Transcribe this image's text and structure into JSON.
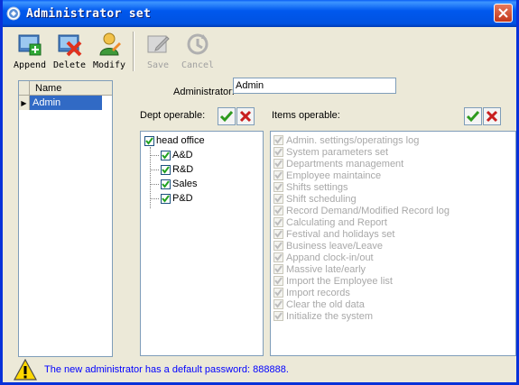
{
  "window": {
    "title": "Administrator set"
  },
  "toolbar": {
    "append": "Append",
    "delete": "Delete",
    "modify": "Modify",
    "save": "Save",
    "cancel": "Cancel"
  },
  "grid": {
    "column": "Name",
    "rows": [
      "Admin"
    ]
  },
  "form": {
    "administrator_label": "Administrator:",
    "administrator_value": "Admin",
    "dept_label": "Dept operable:",
    "items_label": "Items operable:"
  },
  "departments": {
    "root": "head office",
    "children": [
      "A&D",
      "R&D",
      "Sales",
      "P&D"
    ]
  },
  "items": [
    "Admin. settings/operatings log",
    "System parameters set",
    "Departments management",
    "Employee maintaince",
    "Shifts settings",
    "Shift scheduling",
    "Record Demand/Modified Record log",
    "Calculating and Report",
    "Festival and holidays set",
    "Business leave/Leave",
    "Appand clock-in/out",
    "Massive late/early",
    "Import the Employee list",
    "Import records",
    "Clear the old data",
    "Initialize the system"
  ],
  "status": {
    "message": "The new administrator has a default password: 888888."
  },
  "colors": {
    "titlebar": "#0058ee",
    "selection": "#316ac5",
    "status_text": "#0000ff",
    "check_ok": "#2e9a1f",
    "check_x": "#c81e1e"
  }
}
